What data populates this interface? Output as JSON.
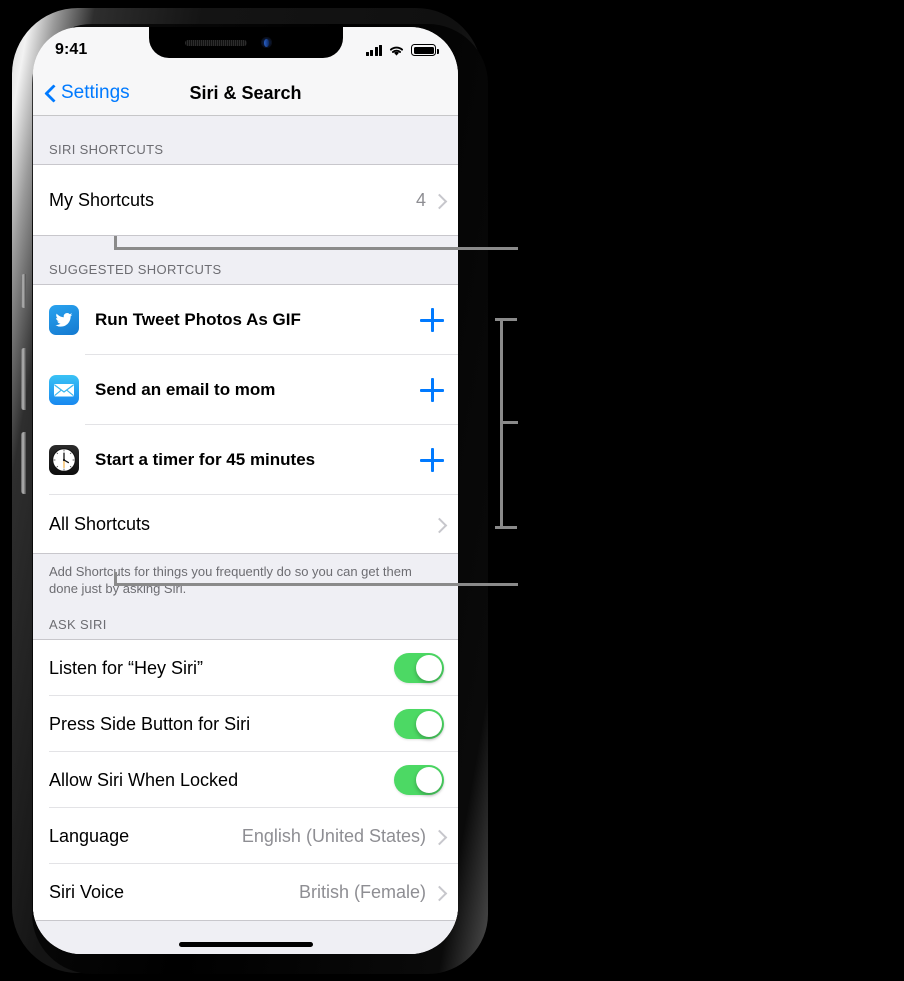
{
  "status_bar": {
    "time": "9:41",
    "signal_icon": "cellular-bars-icon",
    "wifi_icon": "wifi-icon",
    "battery_icon": "battery-full-icon"
  },
  "nav_bar": {
    "back_label": "Settings",
    "back_icon": "chevron-left-icon",
    "title": "Siri & Search"
  },
  "sections": {
    "siri_shortcuts": {
      "header": "SIRI SHORTCUTS",
      "rows": [
        {
          "label": "My Shortcuts",
          "value": "4",
          "accessory": "chevron-right-icon"
        }
      ]
    },
    "suggested_shortcuts": {
      "header": "SUGGESTED SHORTCUTS",
      "rows": [
        {
          "label": "Run Tweet Photos As GIF",
          "icon": "twitter-app-icon",
          "accessory": "plus-icon"
        },
        {
          "label": "Send an email to mom",
          "icon": "mail-app-icon",
          "accessory": "plus-icon"
        },
        {
          "label": "Start a timer for 45 minutes",
          "icon": "clock-app-icon",
          "accessory": "plus-icon"
        }
      ],
      "all_shortcuts": {
        "label": "All Shortcuts",
        "accessory": "chevron-right-icon"
      },
      "footer": "Add Shortcuts for things you frequently do so you can get them done just by asking Siri."
    },
    "ask_siri": {
      "header": "ASK SIRI",
      "rows": [
        {
          "label": "Listen for “Hey Siri”",
          "type": "toggle",
          "on": true
        },
        {
          "label": "Press Side Button for Siri",
          "type": "toggle",
          "on": true
        },
        {
          "label": "Allow Siri When Locked",
          "type": "toggle",
          "on": true
        },
        {
          "label": "Language",
          "type": "value",
          "value": "English (United States)",
          "accessory": "chevron-right-icon"
        },
        {
          "label": "Siri Voice",
          "type": "value",
          "value": "British (Female)",
          "accessory": "chevron-right-icon"
        }
      ]
    }
  },
  "colors": {
    "accent_blue": "#007aff",
    "toggle_green": "#4cd964",
    "group_background": "#efeff4",
    "separator": "#c8c7cc",
    "secondary_text": "#8e8e93",
    "callout_line": "#8a8a8a"
  },
  "annotations": {
    "leader_top": "callout-line-my-shortcuts",
    "bracket": "callout-bracket-suggested-shortcuts",
    "leader_bottom": "callout-line-all-shortcuts"
  }
}
